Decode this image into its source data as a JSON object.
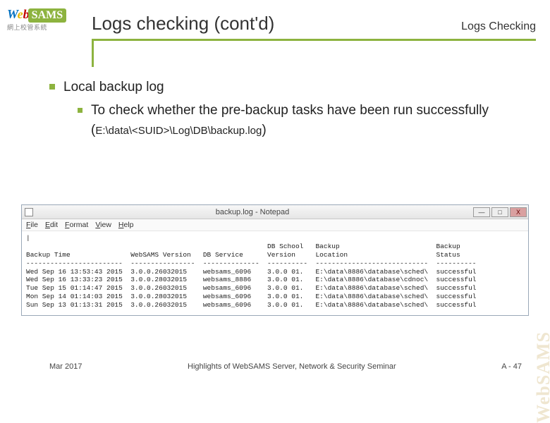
{
  "logo": {
    "text_web": "Web",
    "text_sams": "SAMS",
    "subtitle": "網上校管系統"
  },
  "header": {
    "title": "Logs checking (cont'd)",
    "breadcrumb": "Logs Checking"
  },
  "content": {
    "l1": "Local backup log",
    "l2_prefix": "To check whether the pre-backup tasks have been run successfully (",
    "l2_path": "E:\\data\\<SUID>\\Log\\DB\\backup.log",
    "l2_suffix": ")"
  },
  "notepad": {
    "title": "backup.log - Notepad",
    "menu": [
      "File",
      "Edit",
      "Format",
      "View",
      "Help"
    ],
    "buttons": {
      "min": "—",
      "max": "□",
      "close": "X"
    },
    "columns": [
      "Backup Time",
      "WebSAMS Version",
      "DB Service",
      "DB School Version",
      "Backup Location",
      "Backup Status"
    ],
    "rows": [
      {
        "time": "Wed Sep 16 13:53:43 2015",
        "ver": "3.0.0.26032015",
        "svc": "websams_6096",
        "schver": "3.0.0 01.",
        "loc": "E:\\data\\8886\\database\\sched\\",
        "status": "successful"
      },
      {
        "time": "Wed Sep 16 13:33:23 2015",
        "ver": "3.0.0.28032015",
        "svc": "websams_8886",
        "schver": "3.0.0 01.",
        "loc": "E:\\data\\8886\\database\\cdnoc\\",
        "status": "successful"
      },
      {
        "time": "Tue Sep 15 01:14:47 2015",
        "ver": "3.0.0.26032015",
        "svc": "websams_6096",
        "schver": "3.0.0 01.",
        "loc": "E:\\data\\8886\\database\\sched\\",
        "status": "successful"
      },
      {
        "time": "Mon Sep 14 01:14:03 2015",
        "ver": "3.0.0.28032015",
        "svc": "websams_6096",
        "schver": "3.0.0 01.",
        "loc": "E:\\data\\8886\\database\\sched\\",
        "status": "successful"
      },
      {
        "time": "Sun Sep 13 01:13:31 2015",
        "ver": "3.0.0.26032015",
        "svc": "websams_6096",
        "schver": "3.0.0 01.",
        "loc": "E:\\data\\8886\\database\\sched\\",
        "status": "successful"
      }
    ]
  },
  "footer": {
    "left": "Mar 2017",
    "center": "Highlights of WebSAMS Server, Network & Security Seminar",
    "right": "A - 47"
  },
  "watermark": "WebSAMS"
}
